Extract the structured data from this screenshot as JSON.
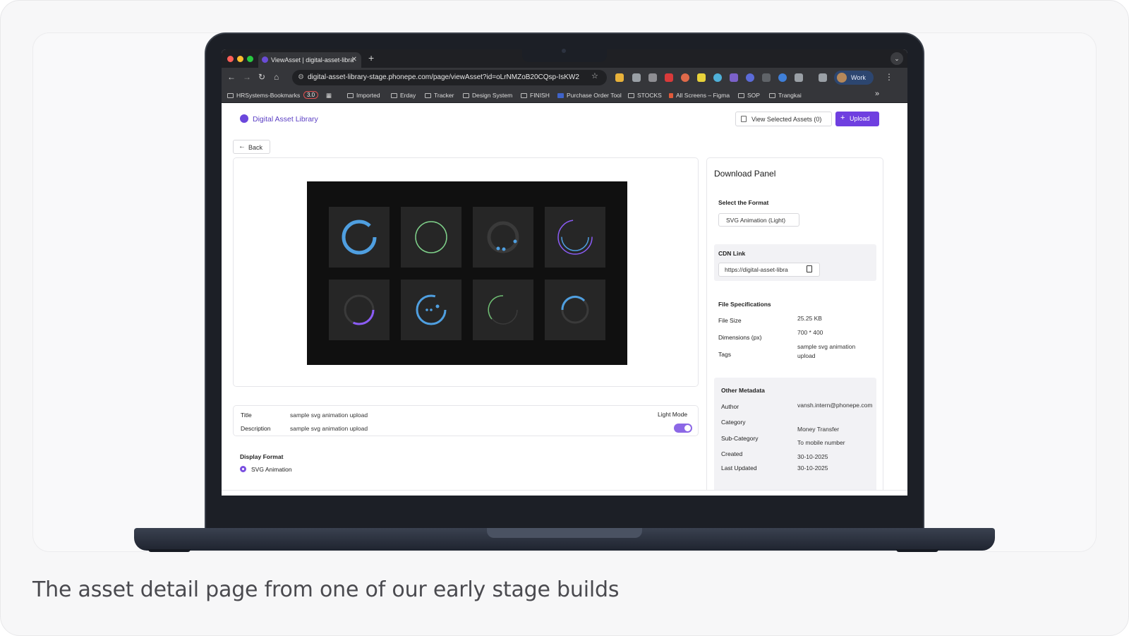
{
  "caption": "The asset detail page from one of our early stage builds",
  "browser": {
    "tab_title": "ViewAsset | digital-asset-libra",
    "url": "digital-asset-library-stage.phonepe.com/page/viewAsset?id=oLrNMZoB20CQsp-IsKW2",
    "profile_label": "Work",
    "bookmarks": [
      "HRSystems-Bookmarks",
      "3.0",
      "Imported",
      "Erday",
      "Tracker",
      "Design System",
      "FINISH",
      "Purchase Order Tool",
      "STOCKS",
      "All Screens – Figma",
      "SOP",
      "Trangkai"
    ],
    "bookmarks_overflow": "»"
  },
  "app": {
    "brand": "Digital Asset Library",
    "view_selected_label": "View Selected Assets (0)",
    "upload_label": "Upload",
    "back_label": "Back",
    "info": {
      "title_label": "Title",
      "title_value": "sample svg animation upload",
      "description_label": "Description",
      "description_value": "sample svg animation upload",
      "light_mode_label": "Light Mode",
      "light_mode_on": true
    },
    "display_format": {
      "heading": "Display Format",
      "option": "SVG Animation"
    },
    "download_panel": {
      "heading": "Download Panel",
      "format_heading": "Select the Format",
      "format_chip": "SVG Animation (Light)",
      "cdn_heading": "CDN Link",
      "cdn_value": "https://digital-asset-libra",
      "specs_heading": "File Specifications",
      "file_size_label": "File Size",
      "file_size_value": "25.25 KB",
      "dimensions_label": "Dimensions (px)",
      "dimensions_value": "700 * 400",
      "tags_label": "Tags",
      "tags_value": "sample svg animation upload",
      "meta_heading": "Other Metadata",
      "author_label": "Author",
      "author_value": "vansh.intern@phonepe.com",
      "category_label": "Category",
      "category_value": "Money Transfer",
      "subcategory_label": "Sub-Category",
      "subcategory_value": "To mobile number",
      "created_label": "Created",
      "created_value": "30-10-2025",
      "updated_label": "Last Updated",
      "updated_value": "30-10-2025"
    },
    "loader_colors": [
      "#4f9fe0",
      "#7fd18a",
      "#4f9fe0",
      "#8b5cf6",
      "#8b5cf6",
      "#4f9fe0",
      "#6fbf73",
      "#4f9fe0"
    ]
  }
}
